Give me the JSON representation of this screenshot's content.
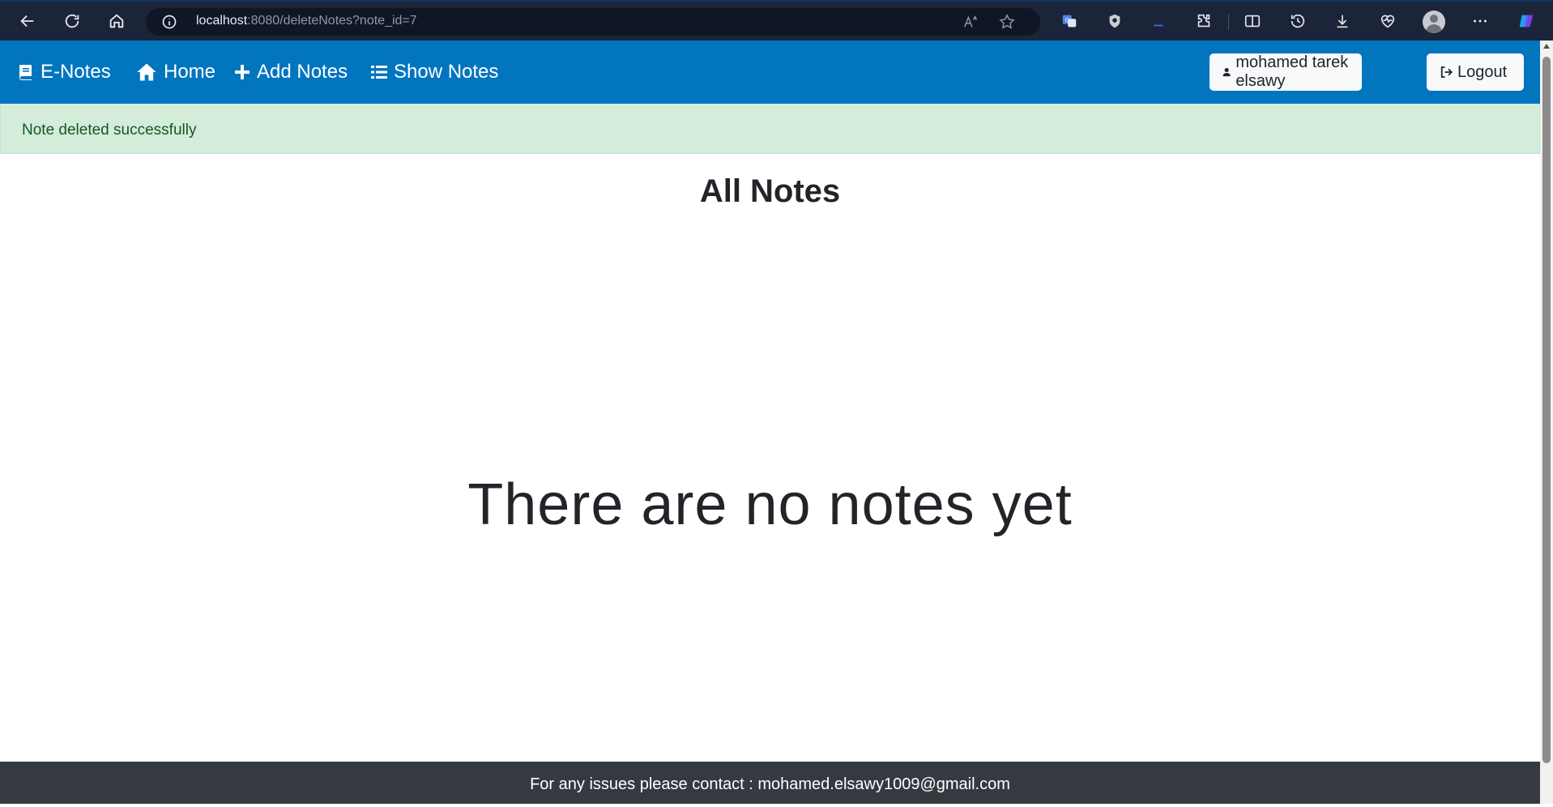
{
  "browser": {
    "url_host": "localhost",
    "url_path": ":8080/deleteNotes?note_id=7"
  },
  "navbar": {
    "brand": "E-Notes",
    "links": [
      {
        "label": "Home",
        "icon": "home-icon"
      },
      {
        "label": "Add Notes",
        "icon": "plus-icon"
      },
      {
        "label": "Show Notes",
        "icon": "list-icon"
      }
    ],
    "user_label": "mohamed tarek elsawy",
    "logout_label": "Logout",
    "color": "#0275bf"
  },
  "alert": {
    "message": "Note deleted successfully",
    "color": "#d4eddb"
  },
  "main": {
    "title": "All Notes",
    "empty_message": "There are no notes yet"
  },
  "footer": {
    "text": "For any issues please contact : mohamed.elsawy1009@gmail.com",
    "color": "#343a40"
  }
}
